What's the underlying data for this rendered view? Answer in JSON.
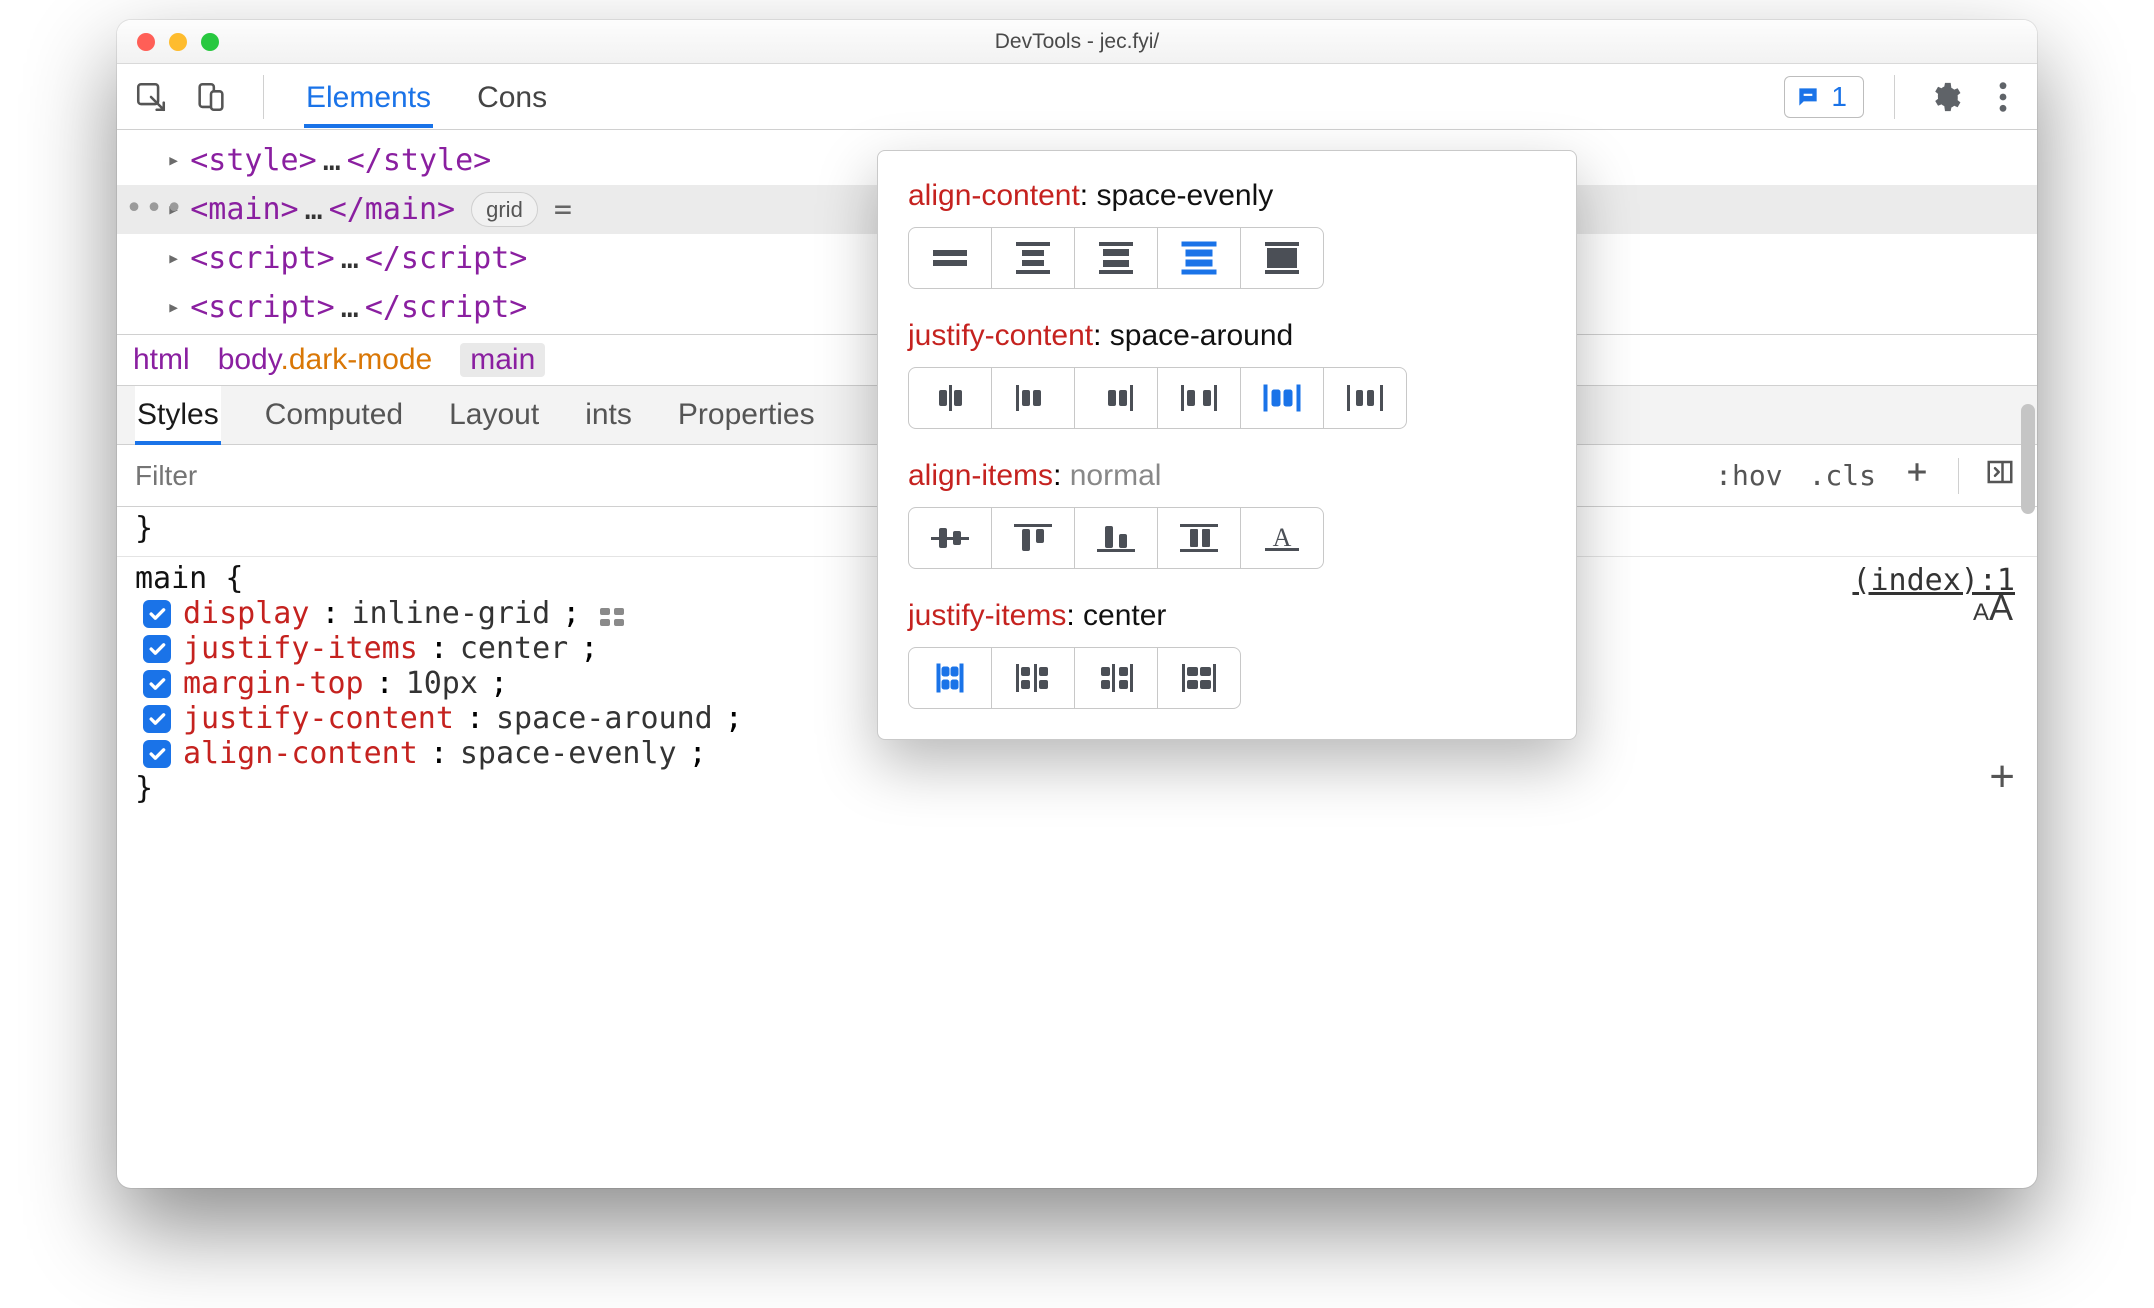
{
  "window": {
    "title": "DevTools - jec.fyi/"
  },
  "toolbar": {
    "tabs": [
      "Elements",
      "Cons"
    ],
    "active_tab_index": 0,
    "issue_count": "1"
  },
  "dom": {
    "rows": [
      {
        "open": "<style>",
        "mid": "…",
        "close": "</style>",
        "selected": false
      },
      {
        "open": "<main>",
        "mid": "…",
        "close": "</main>",
        "selected": true,
        "badge": "grid",
        "suffix": "="
      },
      {
        "open": "<script>",
        "mid": "…",
        "close": "</script>",
        "selected": false
      },
      {
        "open": "<script>",
        "mid": "…",
        "close": "</script>",
        "selected": false
      }
    ]
  },
  "breadcrumbs": {
    "items": [
      {
        "tag": "html",
        "cls": ""
      },
      {
        "tag": "body",
        "cls": ".dark-mode"
      },
      {
        "tag": "main",
        "cls": "",
        "active": true
      }
    ]
  },
  "subtabs": {
    "items": [
      "Styles",
      "Computed",
      "Layout",
      "ints",
      "Properties"
    ],
    "active_index": 0
  },
  "filterbar": {
    "placeholder": "Filter",
    "hov": ":hov",
    "cls": ".cls"
  },
  "styles": {
    "prelude_close": "}",
    "rule": {
      "selector": "main",
      "source": "(index):1",
      "decls": [
        {
          "prop": "display",
          "val": "inline-grid",
          "grid_icon": true
        },
        {
          "prop": "justify-items",
          "val": "center"
        },
        {
          "prop": "margin-top",
          "val": "10px"
        },
        {
          "prop": "justify-content",
          "val": "space-around"
        },
        {
          "prop": "align-content",
          "val": "space-evenly"
        }
      ]
    }
  },
  "popover": {
    "groups": [
      {
        "key": "align-content",
        "value": "space-evenly",
        "dim": false,
        "icons": [
          "ac-center",
          "ac-between",
          "ac-around",
          "ac-evenly",
          "ac-stretch"
        ],
        "selected": 3
      },
      {
        "key": "justify-content",
        "value": "space-around",
        "dim": false,
        "icons": [
          "jc-center",
          "jc-start",
          "jc-end",
          "jc-between",
          "jc-around",
          "jc-evenly"
        ],
        "selected": 4
      },
      {
        "key": "align-items",
        "value": "normal",
        "dim": true,
        "icons": [
          "ai-center",
          "ai-start",
          "ai-end",
          "ai-stretch",
          "ai-baseline"
        ],
        "selected": -1
      },
      {
        "key": "justify-items",
        "value": "center",
        "dim": false,
        "icons": [
          "ji-center",
          "ji-start",
          "ji-end",
          "ji-stretch"
        ],
        "selected": 0
      }
    ]
  }
}
